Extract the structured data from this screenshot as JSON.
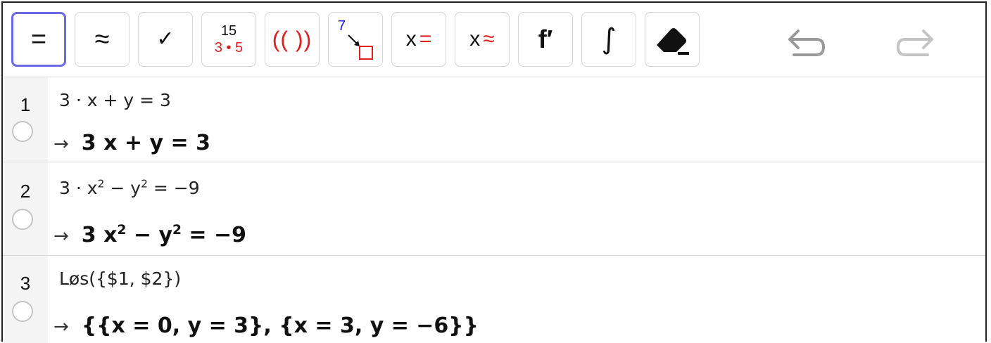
{
  "toolbar": {
    "evaluate_label": "=",
    "numeric_label": "≈",
    "keep_input_label": "✓",
    "factor_top": "15",
    "factor_bottom": "3 • 5",
    "expand_label": "(( ))",
    "substitute_label": "7",
    "solve_label_x": "x",
    "solve_label_eq": "=",
    "nsolve_label_x": "x",
    "nsolve_label_eq": "≈",
    "derivative_label": "f′",
    "integral_label": "∫"
  },
  "rows": [
    {
      "number": "1",
      "input": "3 · x + y  =  3",
      "output_arrow": "→",
      "output": "3 x + y = 3"
    },
    {
      "number": "2",
      "input_a": "3 · x",
      "input_a_exp": "2",
      "input_b": " − y",
      "input_b_exp": "2",
      "input_c": "  =  −9",
      "output_arrow": "→",
      "output_a": "3 x",
      "output_a_exp": "2",
      "output_b": " − y",
      "output_b_exp": "2",
      "output_c": " = −9"
    },
    {
      "number": "3",
      "input": "Løs({$1,  $2})",
      "output_arrow": "→",
      "output": "{{x = 0, y = 3}, {x = 3, y = −6}}"
    }
  ],
  "colors": {
    "active_border": "#6a6ae6",
    "accent_red": "#e02020",
    "accent_blue": "#1515d0",
    "disabled_gray": "#b8b8b8"
  },
  "icons": [
    "undo-icon",
    "redo-icon",
    "eraser-icon",
    "substitute-icon"
  ]
}
